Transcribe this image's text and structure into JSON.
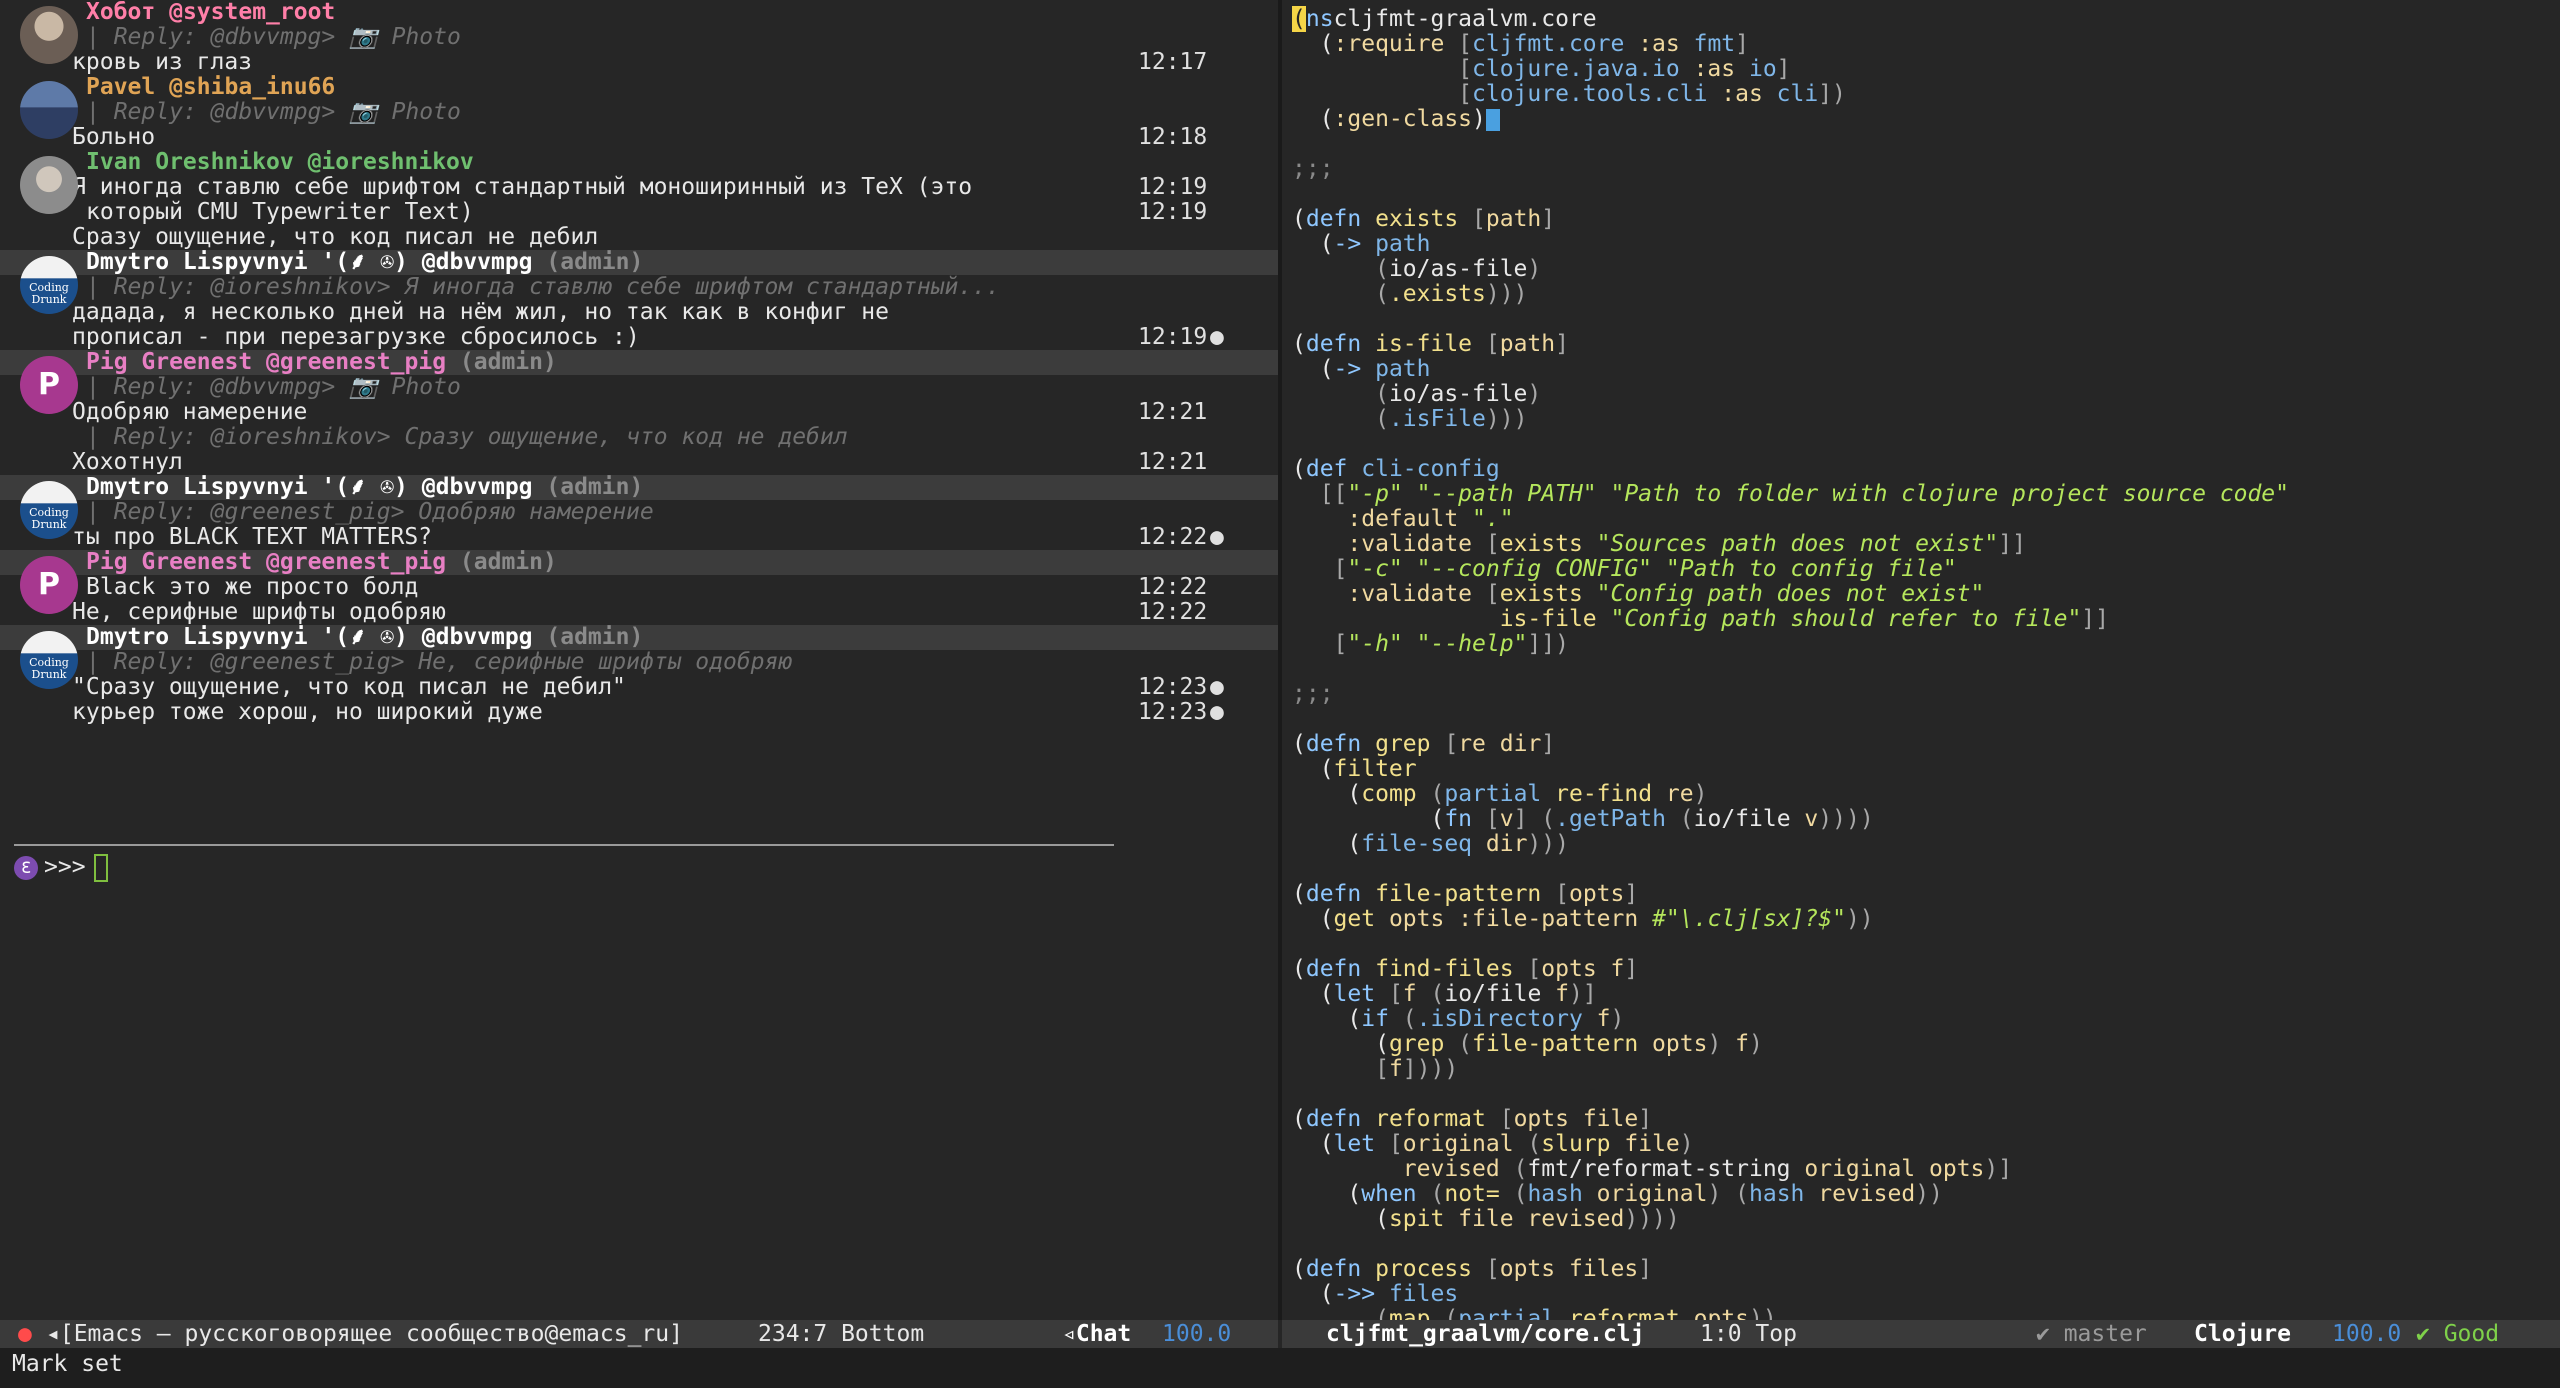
{
  "chat": {
    "messages": [
      {
        "name": "Хобот",
        "handle": "@system_root",
        "role": "",
        "color": "#ff7fa8",
        "avatar": "av-1",
        "reply": "| Reply: @dbvvmpg> 📷 Photo",
        "lines": [
          {
            "text": "кровь из глаз",
            "time": "12:17",
            "mark": ""
          }
        ]
      },
      {
        "name": "Pavel",
        "handle": "@shiba_inu66",
        "role": "",
        "color": "#e0a455",
        "avatar": "av-2",
        "reply": "| Reply: @dbvvmpg> 📷 Photo",
        "lines": [
          {
            "text": "Больно",
            "time": "12:18",
            "mark": ""
          }
        ]
      },
      {
        "name": "Ivan Oreshnikov",
        "handle": "@ioreshnikov",
        "role": "",
        "color": "#6fbf6f",
        "avatar": "av-3",
        "reply": "",
        "lines": [
          {
            "text": "Я иногда ставлю себе шрифтом стандартный моноширинный из TeX (это",
            "time": "12:19",
            "mark": ""
          },
          {
            "text": "который CMU Typewriter Text)",
            "time": "12:19",
            "mark": "",
            "cont": true
          },
          {
            "text": "Сразу ощущение, что код писал не дебил",
            "time": "",
            "mark": ""
          }
        ]
      },
      {
        "name": "Dmytro Lispyvnyi '(⸙ ✇)",
        "handle": "@dbvvmpg",
        "role": "(admin)",
        "color": "#ffffff",
        "avatar": "av-dm",
        "reply": "| Reply: @ioreshnikov> Я иногда ставлю себе шрифтом стандартный...",
        "lines": [
          {
            "text": "дадада, я несколько дней на нём жил, но так как в конфиг не",
            "time": "",
            "mark": ""
          },
          {
            "text": "прописал - при перезагрузке сбросилось :)",
            "time": "12:19",
            "mark": "●"
          }
        ]
      },
      {
        "name": "Pig Greenest",
        "handle": "@greenest_pig",
        "role": "(admin)",
        "color": "#e87fc4",
        "avatar": "av-pig",
        "reply": "| Reply: @dbvvmpg> 📷 Photo",
        "lines": [
          {
            "text": "Одобряю намерение",
            "time": "12:21",
            "mark": ""
          },
          {
            "text": "| Reply: @ioreshnikov> Сразу ощущение, что код не дебил",
            "time": "",
            "mark": "",
            "reply": true
          },
          {
            "text": "Хохотнул",
            "time": "12:21",
            "mark": ""
          }
        ]
      },
      {
        "name": "Dmytro Lispyvnyi '(⸙ ✇)",
        "handle": "@dbvvmpg",
        "role": "(admin)",
        "color": "#ffffff",
        "avatar": "av-dm",
        "reply": "| Reply: @greenest_pig> Одобряю намерение",
        "lines": [
          {
            "text": "ты про BLACK TEXT MATTERS?",
            "time": "12:22",
            "mark": "●"
          }
        ]
      },
      {
        "name": "Pig Greenest",
        "handle": "@greenest_pig",
        "role": "(admin)",
        "color": "#e87fc4",
        "avatar": "av-pig",
        "reply": "",
        "lines": [
          {
            "text": "Black это же просто болд",
            "time": "12:22",
            "mark": "",
            "cont": true
          },
          {
            "text": "Не, серифные шрифты одобряю",
            "time": "12:22",
            "mark": ""
          }
        ]
      },
      {
        "name": "Dmytro Lispyvnyi '(⸙ ✇)",
        "handle": "@dbvvmpg",
        "role": "(admin)",
        "color": "#ffffff",
        "avatar": "av-dm",
        "reply": "| Reply: @greenest_pig> Не, серифные шрифты одобряю",
        "lines": [
          {
            "text": "\"Сразу ощущение, что код писал не дебил\"",
            "time": "12:23",
            "mark": "●"
          },
          {
            "text": "курьер тоже хорош, но широкий дуже",
            "time": "12:23",
            "mark": "●"
          }
        ]
      }
    ],
    "prompt": ">>>",
    "avatar_text_dm": "Coding Drunk",
    "avatar_letter_pig": "P"
  },
  "code_lines": [
    [
      [
        "cur",
        "("
      ],
      [
        "kw",
        "ns"
      ],
      [
        "",
        "cljfmt-graalvm.core"
      ]
    ],
    [
      [
        "",
        "  ("
      ],
      [
        "kwd",
        ":require"
      ],
      [
        "pr",
        " ["
      ],
      [
        "vr",
        "cljfmt.core"
      ],
      [
        "kwd",
        " :as"
      ],
      [
        "vr",
        " fmt"
      ],
      [
        "pr",
        "]"
      ]
    ],
    [
      [
        "pr",
        "            ["
      ],
      [
        "vr",
        "clojure.java.io"
      ],
      [
        "kwd",
        " :as"
      ],
      [
        "vr",
        " io"
      ],
      [
        "pr",
        "]"
      ]
    ],
    [
      [
        "pr",
        "            ["
      ],
      [
        "vr",
        "clojure.tools.cli"
      ],
      [
        "kwd",
        " :as"
      ],
      [
        "vr",
        " cli"
      ],
      [
        "pr",
        "])"
      ]
    ],
    [
      [
        "",
        "  ("
      ],
      [
        "kwd",
        ":gen-class"
      ],
      [
        "",
        ")"
      ],
      [
        "cursor",
        ""
      ]
    ],
    [
      [
        "",
        ""
      ]
    ],
    [
      [
        "cm",
        ";;;"
      ]
    ],
    [
      [
        "",
        ""
      ]
    ],
    [
      [
        "",
        "("
      ],
      [
        "kw",
        "defn"
      ],
      [
        "fn",
        " exists"
      ],
      [
        "pr",
        " ["
      ],
      [
        "kwd",
        "path"
      ],
      [
        "pr",
        "]"
      ]
    ],
    [
      [
        "",
        "  ("
      ],
      [
        "kw",
        "->"
      ],
      [
        "vr",
        " path"
      ]
    ],
    [
      [
        "pr",
        "      ("
      ],
      [
        "",
        "io/as-file"
      ],
      [
        "pr",
        ")"
      ]
    ],
    [
      [
        "pr",
        "      ("
      ],
      [
        "fn",
        ".exists"
      ],
      [
        "pr",
        ")))"
      ]
    ],
    [
      [
        "",
        ""
      ]
    ],
    [
      [
        "",
        "("
      ],
      [
        "kw",
        "defn"
      ],
      [
        "fn",
        " is-file"
      ],
      [
        "pr",
        " ["
      ],
      [
        "kwd",
        "path"
      ],
      [
        "pr",
        "]"
      ]
    ],
    [
      [
        "",
        "  ("
      ],
      [
        "kw",
        "->"
      ],
      [
        "vr",
        " path"
      ]
    ],
    [
      [
        "pr",
        "      ("
      ],
      [
        "",
        "io/as-file"
      ],
      [
        "pr",
        ")"
      ]
    ],
    [
      [
        "pr",
        "      ("
      ],
      [
        "vr",
        ".isFile"
      ],
      [
        "pr",
        ")))"
      ]
    ],
    [
      [
        "",
        ""
      ]
    ],
    [
      [
        "",
        "("
      ],
      [
        "kw",
        "def"
      ],
      [
        "vr",
        " cli-config"
      ]
    ],
    [
      [
        "pr",
        "  [["
      ],
      [
        "st",
        "\"-p\" \"--path PATH\" \"Path to folder with clojure project source code\""
      ]
    ],
    [
      [
        "kwd",
        "    :default"
      ],
      [
        "st",
        " \".\""
      ]
    ],
    [
      [
        "kwd",
        "    :validate"
      ],
      [
        "pr",
        " ["
      ],
      [
        "fn",
        "exists"
      ],
      [
        "st",
        " \"Sources path does not exist\""
      ],
      [
        "pr",
        "]]"
      ]
    ],
    [
      [
        "pr",
        "   ["
      ],
      [
        "st",
        "\"-c\" \"--config CONFIG\" \"Path to config file\""
      ]
    ],
    [
      [
        "kwd",
        "    :validate"
      ],
      [
        "pr",
        " ["
      ],
      [
        "fn",
        "exists"
      ],
      [
        "st",
        " \"Config path does not exist\""
      ]
    ],
    [
      [
        "fn",
        "               is-file"
      ],
      [
        "st",
        " \"Config path should refer to file\""
      ],
      [
        "pr",
        "]]"
      ]
    ],
    [
      [
        "pr",
        "   ["
      ],
      [
        "st",
        "\"-h\" \"--help\""
      ],
      [
        "pr",
        "]])"
      ]
    ],
    [
      [
        "",
        ""
      ]
    ],
    [
      [
        "cm",
        ";;;"
      ]
    ],
    [
      [
        "",
        ""
      ]
    ],
    [
      [
        "",
        "("
      ],
      [
        "kw",
        "defn"
      ],
      [
        "fn",
        " grep"
      ],
      [
        "pr",
        " ["
      ],
      [
        "kwd",
        "re dir"
      ],
      [
        "pr",
        "]"
      ]
    ],
    [
      [
        "",
        "  ("
      ],
      [
        "fn",
        "filter"
      ]
    ],
    [
      [
        "",
        "    ("
      ],
      [
        "fn",
        "comp"
      ],
      [
        "pr",
        " ("
      ],
      [
        "vr",
        "partial"
      ],
      [
        "fn",
        " re-find"
      ],
      [
        "kwd",
        " re"
      ],
      [
        "pr",
        ")"
      ]
    ],
    [
      [
        "",
        "          ("
      ],
      [
        "kw",
        "fn"
      ],
      [
        "pr",
        " ["
      ],
      [
        "kwd",
        "v"
      ],
      [
        "pr",
        "]"
      ],
      [
        "pr",
        " ("
      ],
      [
        "vr",
        ".getPath"
      ],
      [
        "pr",
        " ("
      ],
      [
        "",
        "io/file"
      ],
      [
        "kwd",
        " v"
      ],
      [
        "pr",
        "))))"
      ]
    ],
    [
      [
        "",
        "    ("
      ],
      [
        "vr",
        "file-seq"
      ],
      [
        "kwd",
        " dir"
      ],
      [
        "pr",
        ")))"
      ]
    ],
    [
      [
        "",
        ""
      ]
    ],
    [
      [
        "",
        "("
      ],
      [
        "kw",
        "defn"
      ],
      [
        "fn",
        " file-pattern"
      ],
      [
        "pr",
        " ["
      ],
      [
        "kwd",
        "opts"
      ],
      [
        "pr",
        "]"
      ]
    ],
    [
      [
        "",
        "  ("
      ],
      [
        "fn",
        "get"
      ],
      [
        "kwd",
        " opts"
      ],
      [
        "kwd",
        " :file-pattern"
      ],
      [
        "st",
        " #\"\\.clj[sx]?$\""
      ],
      [
        "pr",
        "))"
      ]
    ],
    [
      [
        "",
        ""
      ]
    ],
    [
      [
        "",
        "("
      ],
      [
        "kw",
        "defn"
      ],
      [
        "fn",
        " find-files"
      ],
      [
        "pr",
        " ["
      ],
      [
        "kwd",
        "opts f"
      ],
      [
        "pr",
        "]"
      ]
    ],
    [
      [
        "",
        "  ("
      ],
      [
        "kw",
        "let"
      ],
      [
        "pr",
        " ["
      ],
      [
        "kwd",
        "f"
      ],
      [
        "pr",
        " ("
      ],
      [
        "",
        "io/file"
      ],
      [
        "kwd",
        " f"
      ],
      [
        "pr",
        ")]"
      ]
    ],
    [
      [
        "",
        "    ("
      ],
      [
        "kw",
        "if"
      ],
      [
        "pr",
        " ("
      ],
      [
        "vr",
        ".isDirectory"
      ],
      [
        "kwd",
        " f"
      ],
      [
        "pr",
        ")"
      ]
    ],
    [
      [
        "",
        "      ("
      ],
      [
        "fn",
        "grep"
      ],
      [
        "pr",
        " ("
      ],
      [
        "fn",
        "file-pattern"
      ],
      [
        "kwd",
        " opts"
      ],
      [
        "pr",
        ")"
      ],
      [
        "kwd",
        " f"
      ],
      [
        "pr",
        ")"
      ]
    ],
    [
      [
        "pr",
        "      ["
      ],
      [
        "kwd",
        "f"
      ],
      [
        "pr",
        "])))"
      ]
    ],
    [
      [
        "",
        ""
      ]
    ],
    [
      [
        "",
        "("
      ],
      [
        "kw",
        "defn"
      ],
      [
        "fn",
        " reformat"
      ],
      [
        "pr",
        " ["
      ],
      [
        "kwd",
        "opts file"
      ],
      [
        "pr",
        "]"
      ]
    ],
    [
      [
        "",
        "  ("
      ],
      [
        "kw",
        "let"
      ],
      [
        "pr",
        " ["
      ],
      [
        "kwd",
        "original"
      ],
      [
        "pr",
        " ("
      ],
      [
        "fn",
        "slurp"
      ],
      [
        "kwd",
        " file"
      ],
      [
        "pr",
        ")"
      ]
    ],
    [
      [
        "kwd",
        "        revised"
      ],
      [
        "pr",
        " ("
      ],
      [
        "",
        "fmt/reformat-string"
      ],
      [
        "kwd",
        " original opts"
      ],
      [
        "pr",
        ")]"
      ]
    ],
    [
      [
        "",
        "    ("
      ],
      [
        "kw",
        "when"
      ],
      [
        "pr",
        " ("
      ],
      [
        "fn",
        "not="
      ],
      [
        "pr",
        " ("
      ],
      [
        "vr",
        "hash"
      ],
      [
        "kwd",
        " original"
      ],
      [
        "pr",
        ")"
      ],
      [
        "pr",
        " ("
      ],
      [
        "vr",
        "hash"
      ],
      [
        "kwd",
        " revised"
      ],
      [
        "pr",
        "))"
      ]
    ],
    [
      [
        "",
        "      ("
      ],
      [
        "fn",
        "spit"
      ],
      [
        "kwd",
        " file revised"
      ],
      [
        "pr",
        "))))"
      ]
    ],
    [
      [
        "",
        ""
      ]
    ],
    [
      [
        "",
        "("
      ],
      [
        "kw",
        "defn"
      ],
      [
        "fn",
        " process"
      ],
      [
        "pr",
        " ["
      ],
      [
        "kwd",
        "opts files"
      ],
      [
        "pr",
        "]"
      ]
    ],
    [
      [
        "",
        "  ("
      ],
      [
        "kw",
        "->>"
      ],
      [
        "vr",
        " files"
      ]
    ],
    [
      [
        "pr",
        "      ("
      ],
      [
        "fn",
        "map"
      ],
      [
        "pr",
        " ("
      ],
      [
        "vr",
        "partial"
      ],
      [
        "fn",
        " reformat"
      ],
      [
        "kwd",
        " opts"
      ],
      [
        "pr",
        "))"
      ]
    ]
  ],
  "modeline_left": {
    "dot": "●",
    "buffer": "◂[Emacs — русскоговорящее сообщество@emacs_ru]",
    "position": "234:7 Bottom",
    "mode": "◃Chat",
    "percent": "100.0"
  },
  "modeline_right": {
    "file": "cljfmt_graalvm/core.clj",
    "position": "1:0 Top",
    "branch": "✔ master",
    "mode": "Clojure",
    "percent": "100.0",
    "status": "✔ Good"
  },
  "minibuffer": "Mark set"
}
